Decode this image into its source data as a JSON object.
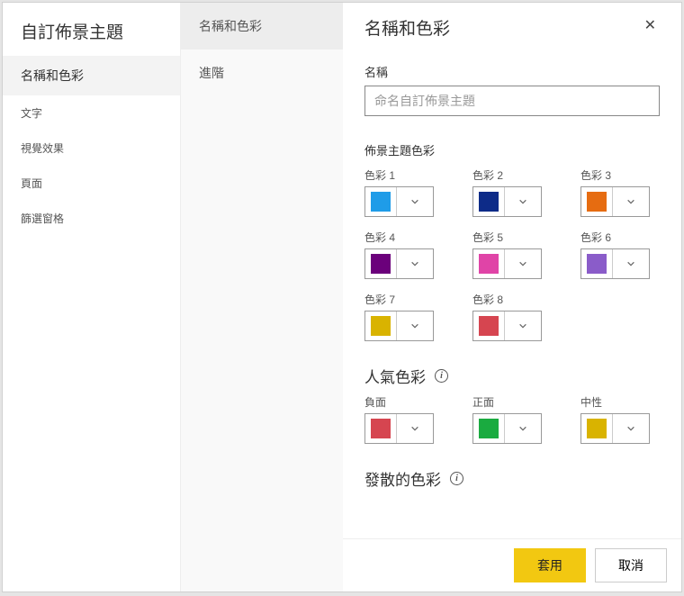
{
  "dialog": {
    "title": "自訂佈景主題",
    "close_icon": "✕"
  },
  "sidebar_left": {
    "items": [
      {
        "label": "名稱和色彩",
        "active": true,
        "sub": false
      },
      {
        "label": "文字",
        "active": false,
        "sub": true
      },
      {
        "label": "視覺效果",
        "active": false,
        "sub": true
      },
      {
        "label": "頁面",
        "active": false,
        "sub": true
      },
      {
        "label": "篩選窗格",
        "active": false,
        "sub": true
      }
    ]
  },
  "sidebar_mid": {
    "items": [
      {
        "label": "名稱和色彩",
        "active": true
      },
      {
        "label": "進階",
        "active": false
      }
    ]
  },
  "main": {
    "title": "名稱和色彩",
    "name_label": "名稱",
    "name_placeholder": "命名自訂佈景主題",
    "theme_colors_title": "佈景主題色彩",
    "theme_colors": [
      {
        "label": "色彩 1",
        "color": "#1f9ce8"
      },
      {
        "label": "色彩 2",
        "color": "#0d2b88"
      },
      {
        "label": "色彩 3",
        "color": "#e66c11"
      },
      {
        "label": "色彩 4",
        "color": "#6b007b"
      },
      {
        "label": "色彩 5",
        "color": "#e044a7"
      },
      {
        "label": "色彩 6",
        "color": "#8a5cc9"
      },
      {
        "label": "色彩 7",
        "color": "#d9b300"
      },
      {
        "label": "色彩 8",
        "color": "#d64550"
      }
    ],
    "popularity_title": "人氣色彩",
    "popularity_colors": [
      {
        "label": "負面",
        "color": "#d64550"
      },
      {
        "label": "正面",
        "color": "#1aab40"
      },
      {
        "label": "中性",
        "color": "#d9b300"
      }
    ],
    "divergent_title": "發散的色彩"
  },
  "footer": {
    "apply": "套用",
    "cancel": "取消"
  }
}
